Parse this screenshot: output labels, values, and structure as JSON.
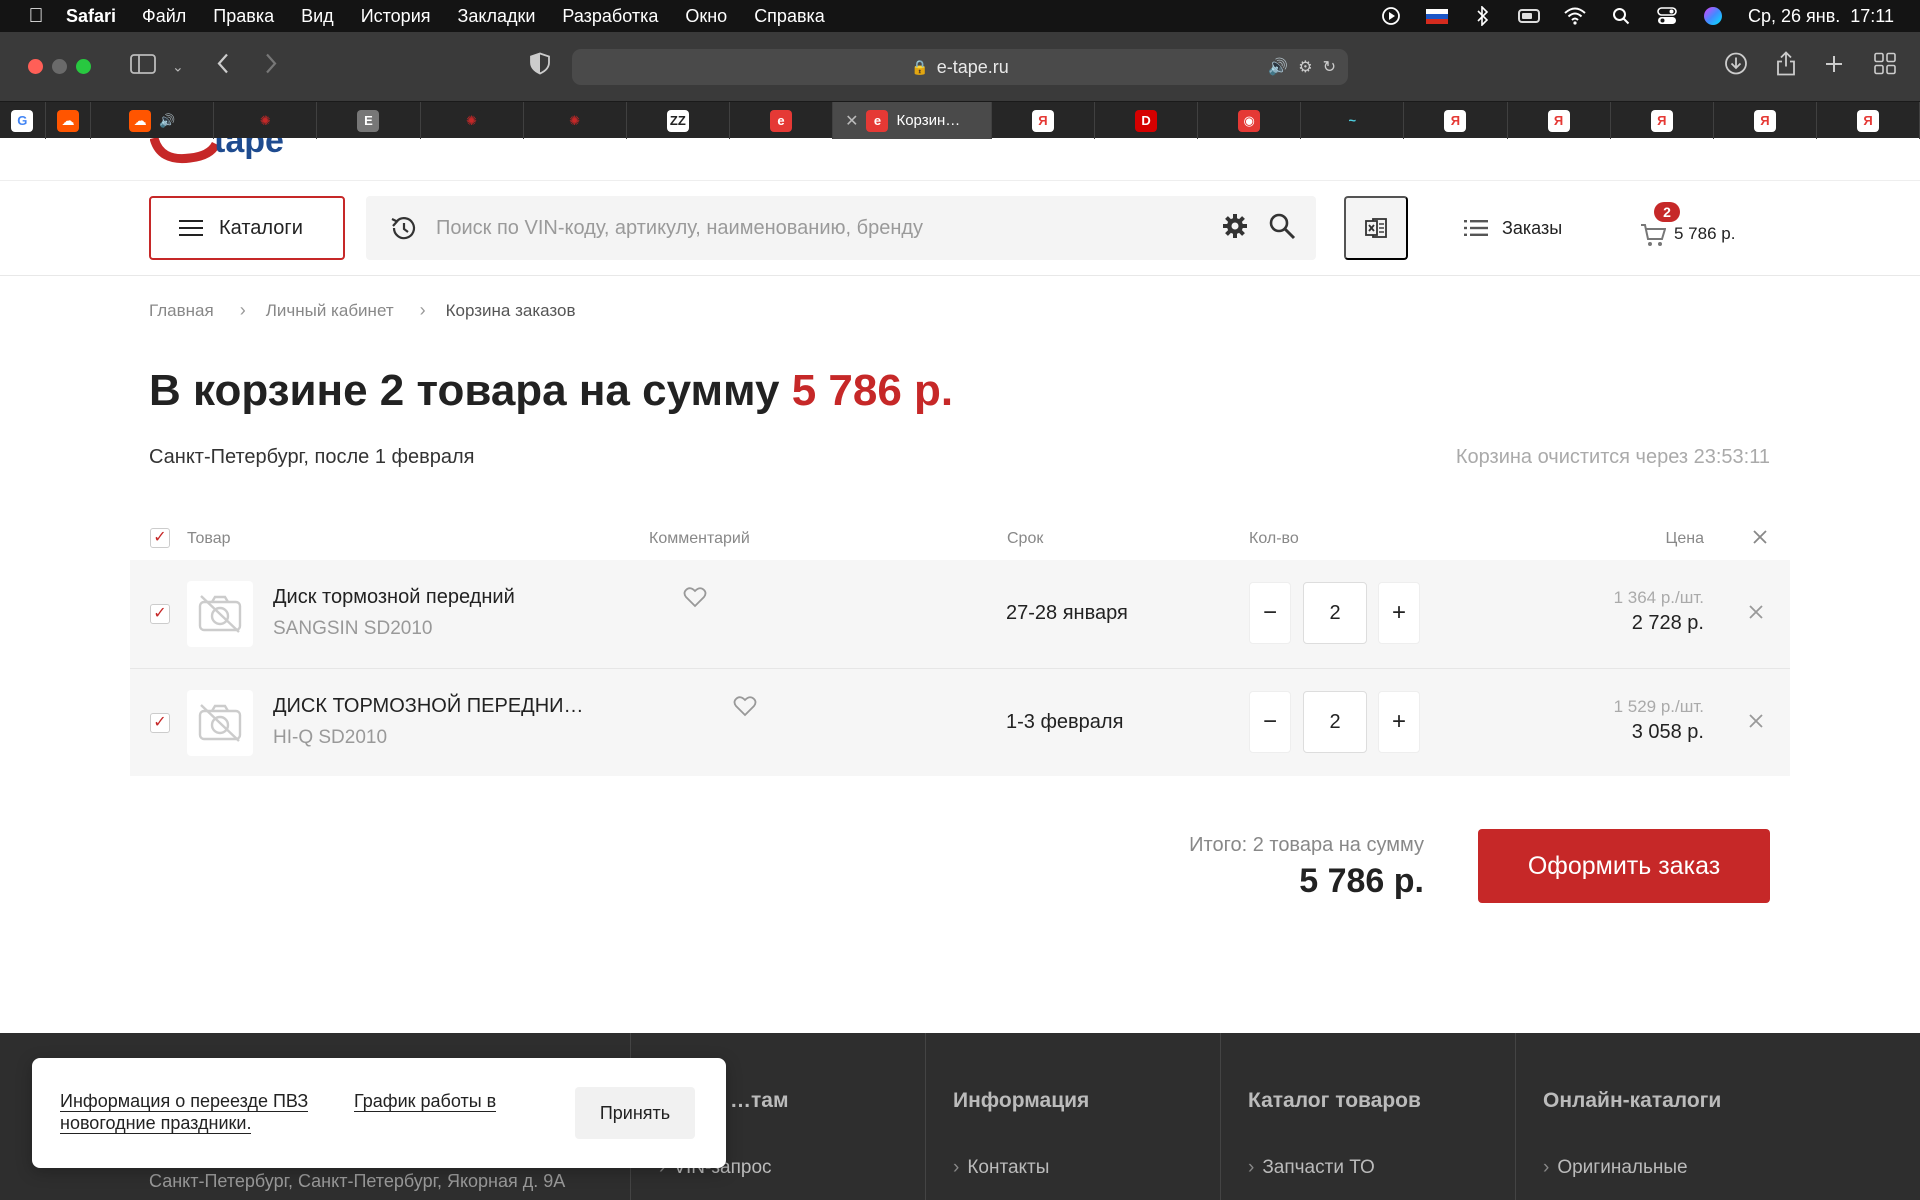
{
  "menubar": {
    "app": "Safari",
    "items": [
      "Файл",
      "Правка",
      "Вид",
      "История",
      "Закладки",
      "Разработка",
      "Окно",
      "Справка"
    ],
    "clock": "Ср, 26 янв.  17:11"
  },
  "browser": {
    "url": "e-tape.ru",
    "active_tab_title": "Корзин…",
    "tab_favicons": [
      {
        "letter": "G",
        "bg": "#ffffff",
        "fg": "#4285f4"
      },
      {
        "letter": "☁",
        "bg": "#ff5500",
        "fg": "#ffffff"
      },
      {
        "letter": "☁",
        "bg": "#ff5500",
        "fg": "#ffffff"
      },
      {
        "letter": "✺",
        "bg": "#262626",
        "fg": "#c62828"
      },
      {
        "letter": "E",
        "bg": "#777777",
        "fg": "#ffffff"
      },
      {
        "letter": "✺",
        "bg": "#262626",
        "fg": "#c62828"
      },
      {
        "letter": "✺",
        "bg": "#262626",
        "fg": "#c62828"
      },
      {
        "letter": "ZZ",
        "bg": "#ffffff",
        "fg": "#222222"
      },
      {
        "letter": "e",
        "bg": "#e53935",
        "fg": "#ffffff"
      }
    ],
    "tab_favicons_after": [
      {
        "letter": "Я",
        "bg": "#ffffff",
        "fg": "#e53935"
      },
      {
        "letter": "D",
        "bg": "#d50000",
        "fg": "#ffffff"
      },
      {
        "letter": "◉",
        "bg": "#e53935",
        "fg": "#ffffff"
      },
      {
        "letter": "~",
        "bg": "#262626",
        "fg": "#4dd0e1"
      },
      {
        "letter": "Я",
        "bg": "#ffffff",
        "fg": "#e53935"
      },
      {
        "letter": "Я",
        "bg": "#ffffff",
        "fg": "#e53935"
      },
      {
        "letter": "Я",
        "bg": "#ffffff",
        "fg": "#e53935"
      },
      {
        "letter": "Я",
        "bg": "#ffffff",
        "fg": "#e53935"
      },
      {
        "letter": "Я",
        "bg": "#ffffff",
        "fg": "#e53935"
      }
    ]
  },
  "header": {
    "catalog_label": "Каталоги",
    "search_placeholder": "Поиск по VIN-коду, артикулу, наименованию, бренду",
    "orders_label": "Заказы",
    "cart_count": "2",
    "cart_sum": "5 786 р."
  },
  "breadcrumb": [
    "Главная",
    "Личный кабинет",
    "Корзина заказов"
  ],
  "page": {
    "title_prefix": "В корзине 2 товара на сумму",
    "title_sum": "5 786 р.",
    "city": "Санкт-Петербург, после 1 февраля",
    "timer": "Корзина очистится через 23:53:11"
  },
  "table": {
    "headers": {
      "product": "Товар",
      "comment": "Комментарий",
      "term": "Срок",
      "qty": "Кол-во",
      "price": "Цена"
    },
    "rows": [
      {
        "name": "Диск тормозной передний",
        "brand": "SANGSIN SD2010",
        "term": "27-28 января",
        "qty": "2",
        "unit_price": "1 364 р./шт.",
        "total": "2 728 р."
      },
      {
        "name": "ДИСК ТОРМОЗНОЙ ПЕРЕДНИ…",
        "brand": "HI-Q SD2010",
        "term": "1-3 февраля",
        "qty": "2",
        "unit_price": "1 529 р./шт.",
        "total": "3 058 р."
      }
    ]
  },
  "total": {
    "label": "Итого: 2 товара на сумму",
    "sum": "5 786 р.",
    "checkout_label": "Оформить заказ"
  },
  "footer": {
    "columns": [
      {
        "title": "…там",
        "link": "VIN-запрос"
      },
      {
        "title": "Информация",
        "link": "Контакты"
      },
      {
        "title": "Каталог товаров",
        "link": "Запчасти ТО"
      },
      {
        "title": "Онлайн-каталоги",
        "link": "Оригинальные"
      }
    ],
    "address": "Санкт-Петербург, Санкт-Петербург, Якорная д. 9А"
  },
  "notice": {
    "text1": "Информация о переезде ПВЗ новогодние праздники.",
    "text2": "График работы в",
    "accept": "Принять"
  },
  "colors": {
    "accent": "#c62828"
  }
}
